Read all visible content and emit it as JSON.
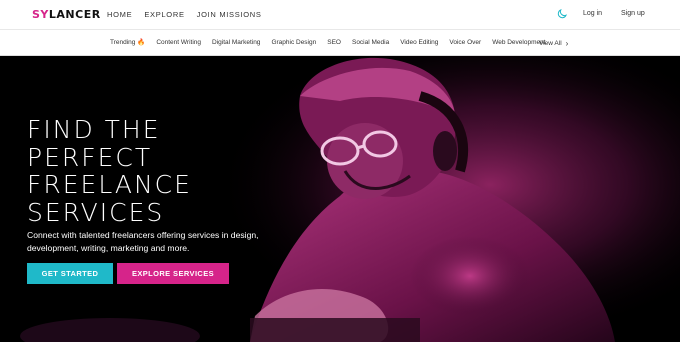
{
  "header": {
    "logo_first": "SY",
    "logo_rest": "LANCER",
    "nav": [
      "HOME",
      "EXPLORE",
      "JOIN MISSIONS"
    ],
    "login": "Log in",
    "signup": "Sign up"
  },
  "categories": {
    "trending": "Trending",
    "items": [
      "Content Writing",
      "Digital Marketing",
      "Graphic Design",
      "SEO",
      "Social Media",
      "Video Editing",
      "Voice Over",
      "Web Development"
    ],
    "view_all": "View All"
  },
  "hero": {
    "title_lines": [
      "FIND THE",
      "PERFECT",
      "FREELANCE",
      "SERVICES"
    ],
    "subtitle": "Connect with talented freelancers offering services in design, development, writing, marketing and more.",
    "primary_button": "GET STARTED",
    "secondary_button": "EXPLORE SERVICES"
  },
  "colors": {
    "accent_pink": "#d6248a",
    "accent_cyan": "#1fb9c9",
    "hero_bg": "#000000"
  },
  "icons": {
    "theme_toggle": "moon-icon",
    "trending": "fire-icon",
    "view_all": "chevron-right-icon"
  }
}
